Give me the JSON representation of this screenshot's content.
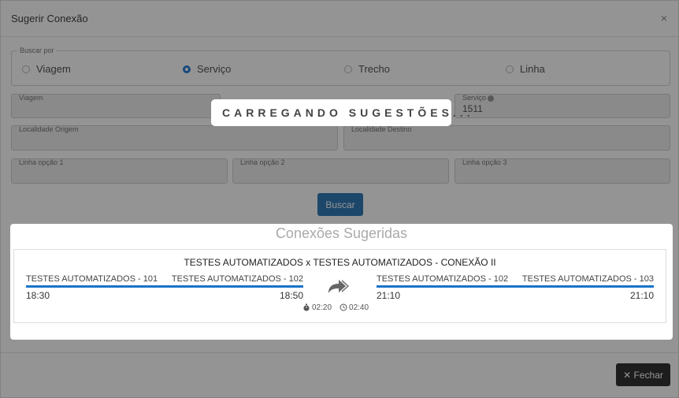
{
  "modal": {
    "title": "Sugerir Conexão",
    "close": "×"
  },
  "search_by": {
    "legend": "Buscar por",
    "options": [
      "Viagem",
      "Serviço",
      "Trecho",
      "Linha"
    ],
    "selected": "Serviço"
  },
  "fields": {
    "viagem": {
      "label": "Viagem",
      "value": ""
    },
    "servico": {
      "label": "Serviço",
      "value": "1511"
    },
    "origem": {
      "label": "Localidade Origem",
      "value": ""
    },
    "destino": {
      "label": "Localidade Destino",
      "value": ""
    },
    "linha1": {
      "label": "Linha opção 1",
      "value": ""
    },
    "linha2": {
      "label": "Linha opção 2",
      "value": ""
    },
    "linha3": {
      "label": "Linha opção 3",
      "value": ""
    }
  },
  "buttons": {
    "buscar": "Buscar",
    "fechar": "Fechar"
  },
  "loading": {
    "text": "CARREGANDO SUGESTÕES..."
  },
  "suggestions": {
    "title": "Conexões Sugeridas",
    "items": [
      {
        "title": "TESTES AUTOMATIZADOS x TESTES AUTOMATIZADOS - CONEXÃO II",
        "leg1": {
          "from": "TESTES AUTOMATIZADOS - 101",
          "to": "TESTES AUTOMATIZADOS - 102",
          "depart": "18:30",
          "arrive": "18:50"
        },
        "leg2": {
          "from": "TESTES AUTOMATIZADOS - 102",
          "to": "TESTES AUTOMATIZADOS - 103",
          "depart": "21:10",
          "arrive": "21:10"
        },
        "wait_time": "02:20",
        "total_time": "02:40"
      }
    ]
  },
  "colors": {
    "accent": "#1a73c8",
    "primary_button": "#337ab7",
    "dark_button": "#333333"
  }
}
